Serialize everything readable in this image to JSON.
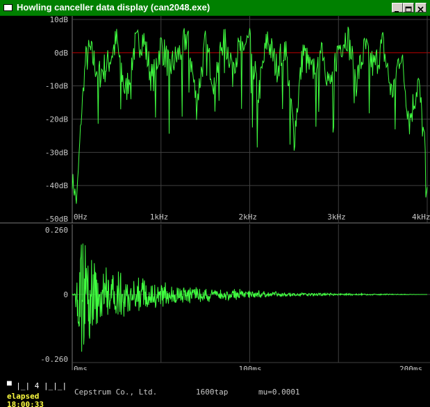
{
  "window": {
    "title": "Howling canceller data display (can2048.exe)",
    "controls": [
      "minimize-icon",
      "maximize-icon",
      "close-icon"
    ],
    "titlebar_color": "#008000"
  },
  "spectrum_panel": {
    "y_tick_labels": [
      "10dB",
      "0dB",
      "-10dB",
      "-20dB",
      "-30dB",
      "-40dB",
      "-50dB"
    ],
    "x_tick_labels": [
      "0Hz",
      "1kHz",
      "2kHz",
      "3kHz",
      "4kHz"
    ],
    "trace_color": "#40ff40",
    "reference_line_color": "#c00000"
  },
  "impulse_panel": {
    "y_tick_labels": [
      "0.260",
      "0",
      "-0.260"
    ],
    "x_tick_labels": [
      "0ms",
      "100ms",
      "200ms"
    ],
    "trace_color": "#40ff40"
  },
  "chart_data": [
    {
      "type": "line",
      "title": "",
      "xlabel": "",
      "ylabel": "",
      "xlim": [
        0,
        4000
      ],
      "ylim": [
        -50,
        10
      ],
      "grid": true,
      "x": [
        0,
        50,
        100,
        150,
        200,
        300,
        400,
        500,
        600,
        700,
        800,
        900,
        1000,
        1100,
        1200,
        1300,
        1400,
        1500,
        1600,
        1700,
        1800,
        1900,
        2000,
        2100,
        2200,
        2300,
        2400,
        2500,
        2600,
        2700,
        2800,
        2900,
        3000,
        3100,
        3200,
        3300,
        3400,
        3500,
        3600,
        3700,
        3800,
        3900,
        4000
      ],
      "series": [
        {
          "values": [
            -38,
            -45,
            -20,
            -2,
            1,
            -6,
            -3,
            4,
            -12,
            2,
            5,
            -8,
            3,
            -4,
            0,
            6,
            -15,
            3,
            -8,
            5,
            -2,
            2,
            4,
            -12,
            5,
            -4,
            3,
            -25,
            1,
            -6,
            5,
            -10,
            2,
            6,
            -8,
            2,
            -4,
            3,
            -12,
            1,
            -20,
            -8,
            -36
          ]
        }
      ]
    },
    {
      "type": "line",
      "title": "",
      "xlabel": "",
      "ylabel": "",
      "xlim": [
        0,
        200
      ],
      "ylim": [
        -0.26,
        0.26
      ],
      "grid": true,
      "x": [
        0,
        5,
        10,
        15,
        20,
        30,
        40,
        50,
        60,
        80,
        100,
        120,
        150,
        175,
        200
      ],
      "series": [
        {
          "values": [
            0,
            0.26,
            -0.2,
            0.15,
            -0.12,
            0.1,
            -0.08,
            0.06,
            -0.05,
            0.03,
            0.02,
            -0.01,
            0.005,
            0.003,
            0.0
          ]
        }
      ]
    }
  ],
  "status_bar": {
    "mini_controls": [
      "▀",
      "|_|",
      "4",
      "|_|_|"
    ],
    "elapsed_label": "elapsed",
    "elapsed_time": "18:00:33",
    "company": "Cepstrum Co., Ltd.",
    "taps": "1600tap",
    "mu": "mu=0.0001",
    "progress_fraction": 0.22
  }
}
